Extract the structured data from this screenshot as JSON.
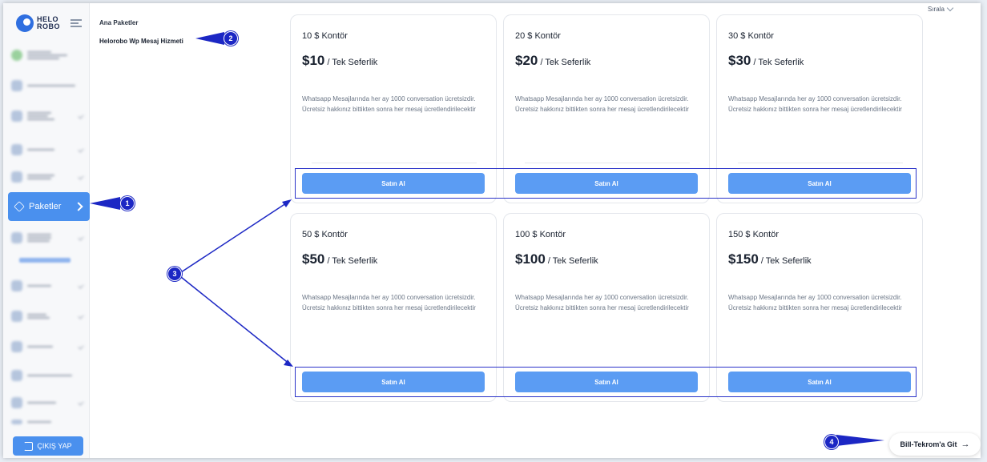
{
  "app": {
    "logo_text_top": "HELO",
    "logo_text_bottom": "ROBO"
  },
  "breadcrumb": {
    "level1": "Ana Paketler",
    "level2": "Helorobo Wp Mesaj Hizmeti"
  },
  "sort": {
    "label": "Sırala"
  },
  "sidebar": {
    "active_item": {
      "label": "Paketler",
      "icon": "package-icon"
    },
    "logout_label": "ÇIKIŞ YAP"
  },
  "cards": [
    {
      "title": "10 $ Kontör",
      "price": "$10",
      "period": "/ Tek Seferlik",
      "description": "Whatsapp Mesajlarında her ay 1000 conversation ücretsizdir. Ücretsiz hakkınız bittikten sonra her mesaj ücretlendirilecektir",
      "button": "Satın Al"
    },
    {
      "title": "20 $ Kontör",
      "price": "$20",
      "period": "/ Tek Seferlik",
      "description": "Whatsapp Mesajlarında her ay 1000 conversation ücretsizdir. Ücretsiz hakkınız bittikten sonra her mesaj ücretlendirilecektir",
      "button": "Satın Al"
    },
    {
      "title": "30 $ Kontör",
      "price": "$30",
      "period": "/ Tek Seferlik",
      "description": "Whatsapp Mesajlarında her ay 1000 conversation ücretsizdir. Ücretsiz hakkınız bittikten sonra her mesaj ücretlendirilecektir",
      "button": "Satın Al"
    },
    {
      "title": "50 $ Kontör",
      "price": "$50",
      "period": "/ Tek Seferlik",
      "description": "Whatsapp Mesajlarında her ay 1000 conversation ücretsizdir. Ücretsiz hakkınız bittikten sonra her mesaj ücretlendirilecektir",
      "button": "Satın Al"
    },
    {
      "title": "100 $ Kontör",
      "price": "$100",
      "period": "/ Tek Seferlik",
      "description": "Whatsapp Mesajlarında her ay 1000 conversation ücretsizdir. Ücretsiz hakkınız bittikten sonra her mesaj ücretlendirilecektir",
      "button": "Satın Al"
    },
    {
      "title": "150 $ Kontör",
      "price": "$150",
      "period": "/ Tek Seferlik",
      "description": "Whatsapp Mesajlarında her ay 1000 conversation ücretsizdir. Ücretsiz hakkınız bittikten sonra her mesaj ücretlendirilecektir",
      "button": "Satın Al"
    }
  ],
  "bill_button": {
    "label": "Bill-Tekrom'a Git",
    "icon": "arrow-right-icon"
  },
  "annotations": {
    "c1": "1",
    "c2": "2",
    "c3": "3",
    "c4": "4"
  },
  "colors": {
    "accent": "#4a90ee",
    "button": "#5b9cf3",
    "annotation": "#1c27c4"
  }
}
